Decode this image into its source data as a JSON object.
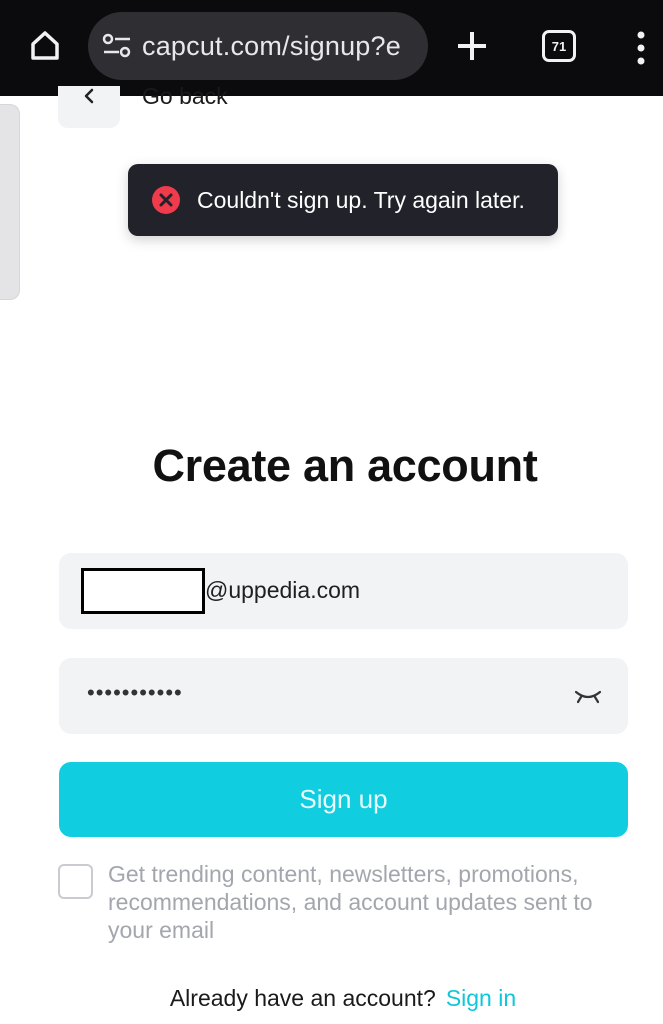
{
  "browser": {
    "url": "capcut.com/signup?e",
    "tab_count": "71",
    "icons": {
      "home": "home-icon",
      "site_settings": "tune-icon",
      "new_tab": "plus-icon",
      "menu": "more-vert-icon"
    }
  },
  "page": {
    "back_label": "Go back",
    "toast": {
      "message": "Couldn't sign up. Try again later.",
      "icon": "error-icon",
      "icon_color": "#ef3b4b"
    },
    "title": "Create an account",
    "email": {
      "value_visible": "@uppedia.com"
    },
    "password": {
      "value": "•••••••••••",
      "toggle_icon": "eye-closed-icon"
    },
    "signup_button": "Sign up",
    "consent_text": "Get trending content, newsletters, promotions, recommendations, and account updates sent to your email",
    "signin_prompt": "Already have an account?",
    "signin_link": "Sign in"
  },
  "colors": {
    "accent": "#10cde0",
    "link": "#10c6da",
    "toast_bg": "#22222a",
    "field_bg": "#f2f3f5"
  }
}
